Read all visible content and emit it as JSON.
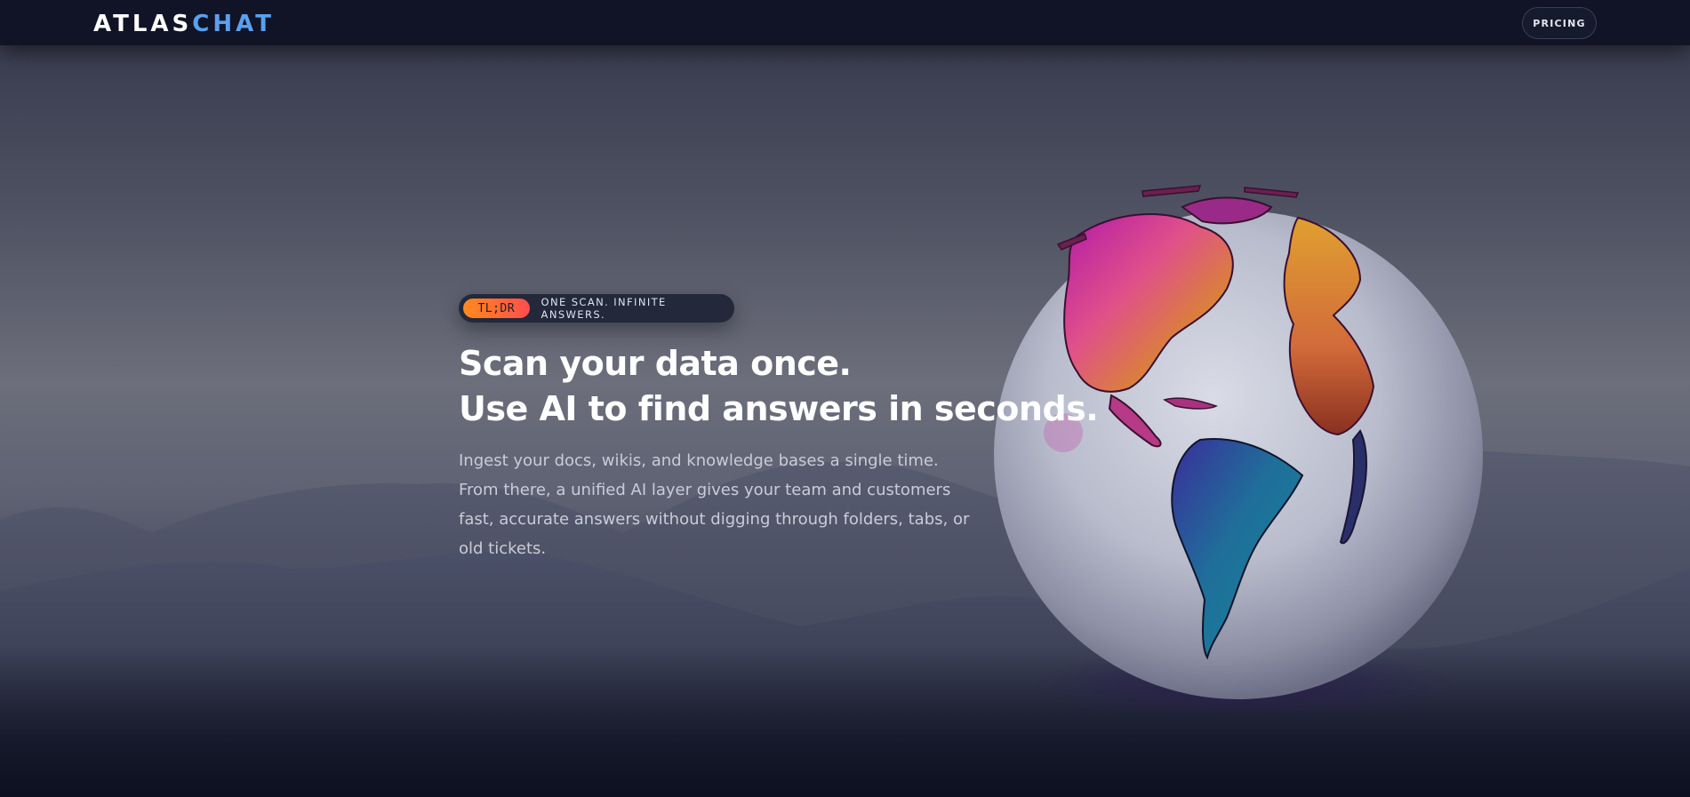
{
  "navbar": {
    "logo_main": "ATLAS",
    "logo_accent": "CHAT",
    "pricing_label": "PRICING"
  },
  "hero": {
    "badge_tag": "TL;DR",
    "badge_text": "ONE SCAN. INFINITE ANSWERS.",
    "headline_lines": [
      "Scan your data once.",
      "Use AI to find answers in seconds."
    ],
    "description_lines": [
      "Ingest your docs, wikis, and knowledge bases a single time.",
      "From there, a unified AI layer gives your team and customers",
      "fast, accurate answers without digging through folders, tabs, or",
      "old tickets."
    ]
  },
  "colors": {
    "navbar_bg": "#111426",
    "logo_accent": "#5aa0f0",
    "badge_gradient_start": "#ff8a1e",
    "badge_gradient_end": "#ff4d4d",
    "headline": "#ffffff",
    "description": "#c9ccd8"
  },
  "icons": {
    "hero_illustration": "globe-icon"
  }
}
